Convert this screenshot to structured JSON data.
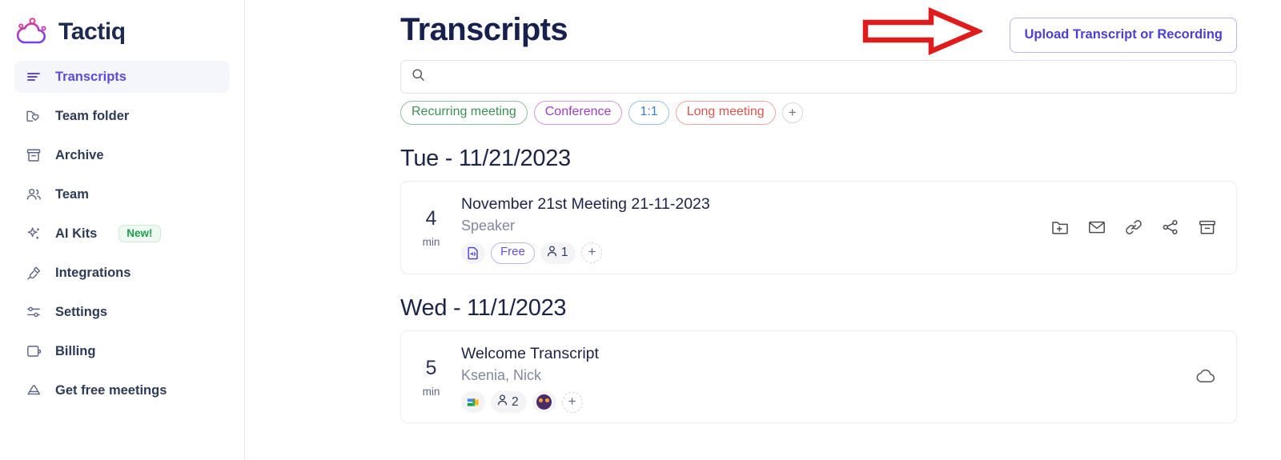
{
  "brand": {
    "name": "Tactiq",
    "logo_icon": "tactiq-cloud-logo",
    "gradient_from": "#e0399a",
    "gradient_to": "#7b3fe4"
  },
  "sidebar": {
    "items": [
      {
        "label": "Transcripts",
        "icon": "lines-icon",
        "active": true
      },
      {
        "label": "Team folder",
        "icon": "folder-heart-icon",
        "active": false
      },
      {
        "label": "Archive",
        "icon": "archive-box-icon",
        "active": false
      },
      {
        "label": "Team",
        "icon": "people-icon",
        "active": false
      },
      {
        "label": "AI Kits",
        "icon": "sparkles-icon",
        "active": false,
        "badge": "New!"
      },
      {
        "label": "Integrations",
        "icon": "plug-icon",
        "active": false
      },
      {
        "label": "Settings",
        "icon": "sliders-icon",
        "active": false
      },
      {
        "label": "Billing",
        "icon": "wallet-icon",
        "active": false
      },
      {
        "label": "Get free meetings",
        "icon": "gift-tag-icon",
        "active": false
      }
    ]
  },
  "header": {
    "title": "Transcripts",
    "upload_button": "Upload Transcript or Recording",
    "annotation_icon": "red-right-arrow",
    "annotation_color": "#e01b1b",
    "accent_color": "#4c3fd6"
  },
  "search": {
    "icon": "search-icon",
    "value": "",
    "placeholder": ""
  },
  "filters": {
    "add_label": "+",
    "tags": [
      {
        "label": "Recurring meeting",
        "color": "#3f8f54"
      },
      {
        "label": "Conference",
        "color": "#9b3fc4"
      },
      {
        "label": "1:1",
        "color": "#3b7fd4"
      },
      {
        "label": "Long meeting",
        "color": "#d9544e"
      }
    ]
  },
  "groups": [
    {
      "date": "Tue - 11/21/2023",
      "rows": [
        {
          "duration": "4",
          "duration_unit": "min",
          "title": "November 21st Meeting 21-11-2023",
          "subtitle": "Speaker",
          "source_icon": "audio-file-icon",
          "plan_badge": "Free",
          "participants_icon": "person-icon",
          "participants_count": "1",
          "add_label": "+",
          "has_avatar": false,
          "actions": [
            {
              "icon": "folder-plus-icon"
            },
            {
              "icon": "mail-icon"
            },
            {
              "icon": "link-icon"
            },
            {
              "icon": "share-icon"
            },
            {
              "icon": "archive-icon"
            }
          ]
        }
      ]
    },
    {
      "date": "Wed - 11/1/2023",
      "rows": [
        {
          "duration": "5",
          "duration_unit": "min",
          "title": "Welcome Transcript",
          "subtitle": "Ksenia, Nick",
          "source_icon": "google-meet-icon",
          "plan_badge": "",
          "participants_icon": "person-icon",
          "participants_count": "2",
          "add_label": "+",
          "has_avatar": true,
          "actions": [
            {
              "icon": "cloud-icon"
            }
          ]
        }
      ]
    }
  ]
}
